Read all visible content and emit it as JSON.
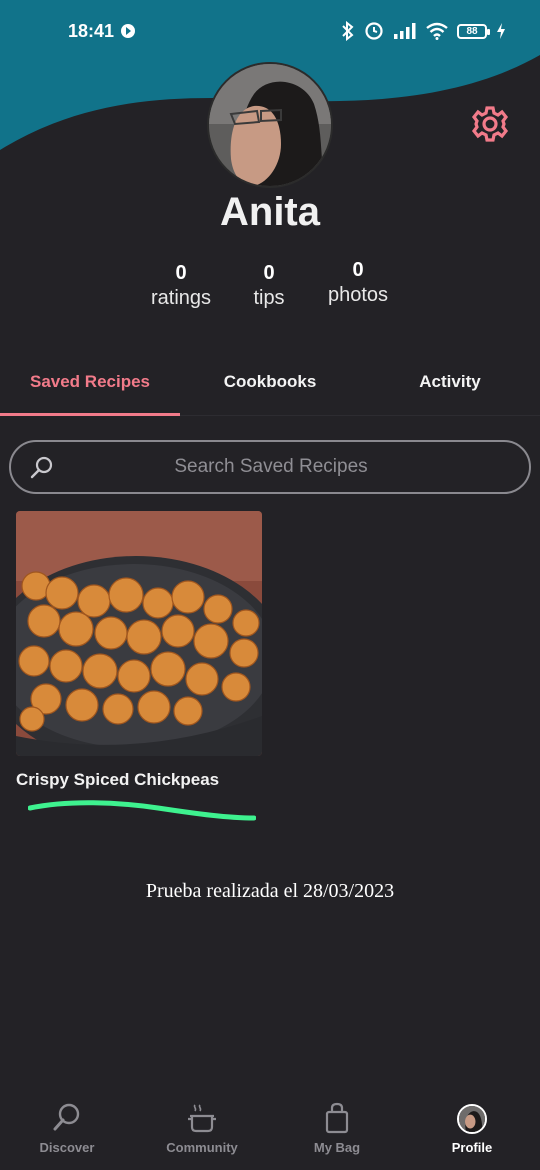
{
  "colors": {
    "header_teal": "#11738a",
    "background": "#232226",
    "accent_pink": "#f27b8a",
    "annotation_green": "#3ef28f"
  },
  "status_bar": {
    "time": "18:41",
    "battery": "88",
    "icons": [
      "bluetooth-icon",
      "alarm-icon",
      "signal-icon",
      "wifi-icon",
      "battery-icon",
      "charging-icon"
    ]
  },
  "profile": {
    "name": "Anita",
    "stats": [
      {
        "value": "0",
        "label": "ratings"
      },
      {
        "value": "0",
        "label": "tips"
      },
      {
        "value": "0",
        "label": "photos"
      }
    ]
  },
  "tabs": [
    {
      "label": "Saved Recipes",
      "active": true
    },
    {
      "label": "Cookbooks",
      "active": false
    },
    {
      "label": "Activity",
      "active": false
    }
  ],
  "search": {
    "placeholder": "Search Saved Recipes"
  },
  "recipes": [
    {
      "title": "Crispy Spiced Chickpeas"
    }
  ],
  "note": "Prueba realizada el 28/03/2023",
  "bottom_nav": [
    {
      "label": "Discover",
      "icon": "search-icon",
      "active": false
    },
    {
      "label": "Community",
      "icon": "pot-icon",
      "active": false
    },
    {
      "label": "My Bag",
      "icon": "shopping-bag-icon",
      "active": false
    },
    {
      "label": "Profile",
      "icon": "avatar-icon",
      "active": true
    }
  ]
}
